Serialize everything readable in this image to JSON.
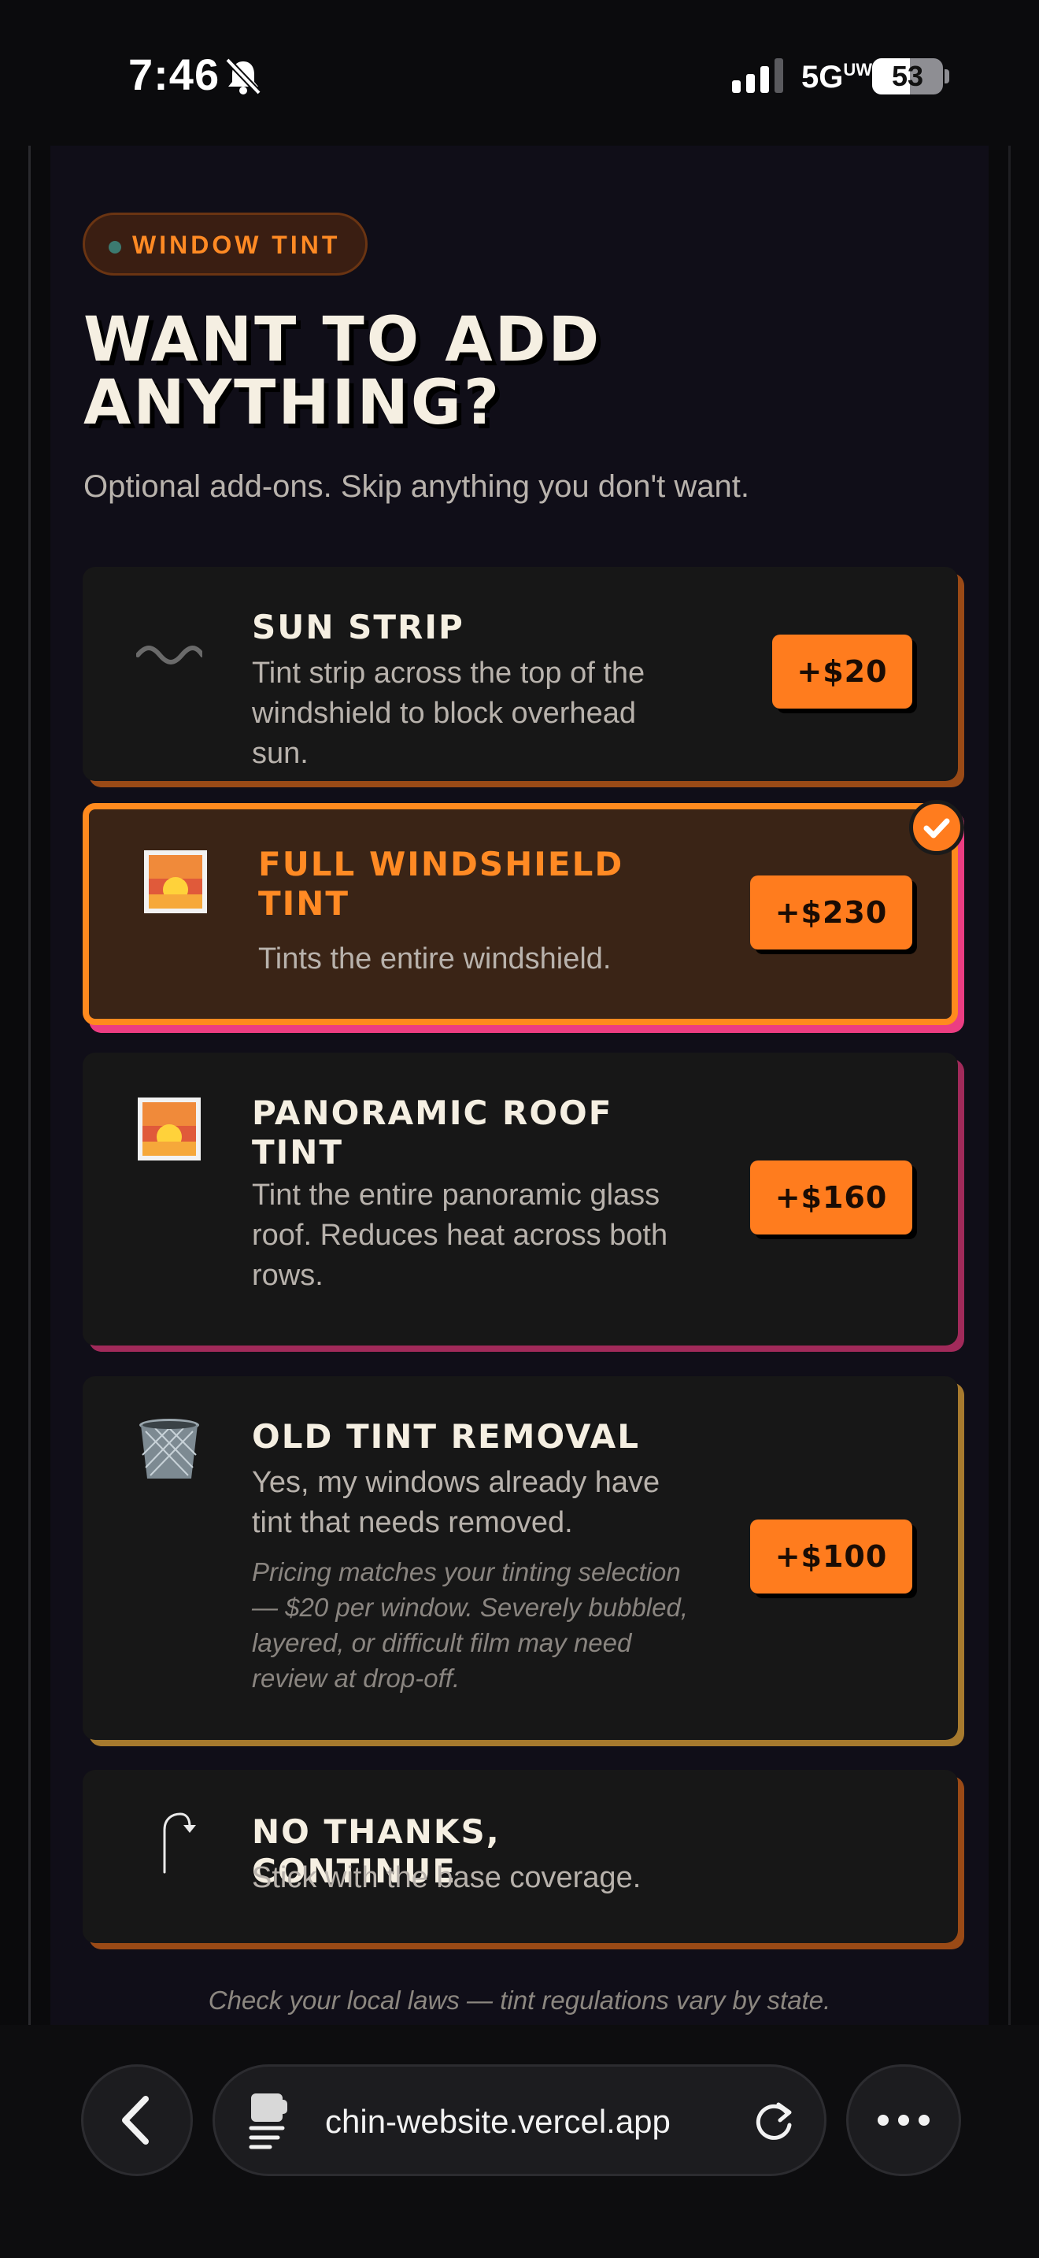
{
  "status_bar": {
    "time": "7:46",
    "network": "5G",
    "network_sup": "UW",
    "battery": "53"
  },
  "header": {
    "category": "WINDOW TINT",
    "title_line1": "WANT TO ADD",
    "title_line2": "ANYTHING?",
    "subtitle": "Optional add-ons. Skip anything you don't want."
  },
  "options": [
    {
      "title": "SUN STRIP",
      "description_line1": "Tint strip across the top of the",
      "description_line2": "windshield to block overhead sun.",
      "price": "+$20",
      "icon": "wave-icon",
      "selected": false
    },
    {
      "title_line1": "FULL WINDSHIELD",
      "title_line2": "TINT",
      "description": "Tints the entire windshield.",
      "price": "+$230",
      "icon": "sunrise-icon",
      "selected": true
    },
    {
      "title_line1": "PANORAMIC ROOF",
      "title_line2": "TINT",
      "description_line1": "Tint the entire panoramic glass",
      "description_line2": "roof. Reduces heat across both",
      "description_line3": "rows.",
      "price": "+$160",
      "icon": "sunrise-icon",
      "selected": false
    },
    {
      "title": "OLD TINT REMOVAL",
      "description_line1": "Yes, my windows already have",
      "description_line2": "tint that needs removed.",
      "note_line1": "Pricing matches your tinting selection",
      "note_line2": "— $20 per window. Severely bubbled,",
      "note_line3": "layered, or difficult film may need",
      "note_line4": "review at drop-off.",
      "price": "+$100",
      "icon": "trash-icon",
      "selected": false
    },
    {
      "title": "NO THANKS, CONTINUE",
      "description": "Stick with the base coverage.",
      "icon": "arrow-return-icon",
      "selected": false
    }
  ],
  "footnote": "Check your local laws — tint regulations vary by state.",
  "browser": {
    "url": "chin-website.vercel.app"
  },
  "colors": {
    "accent": "#ff7c1e",
    "panel": "#100e18",
    "card": "#171717",
    "selected_card": "#3a2416"
  }
}
